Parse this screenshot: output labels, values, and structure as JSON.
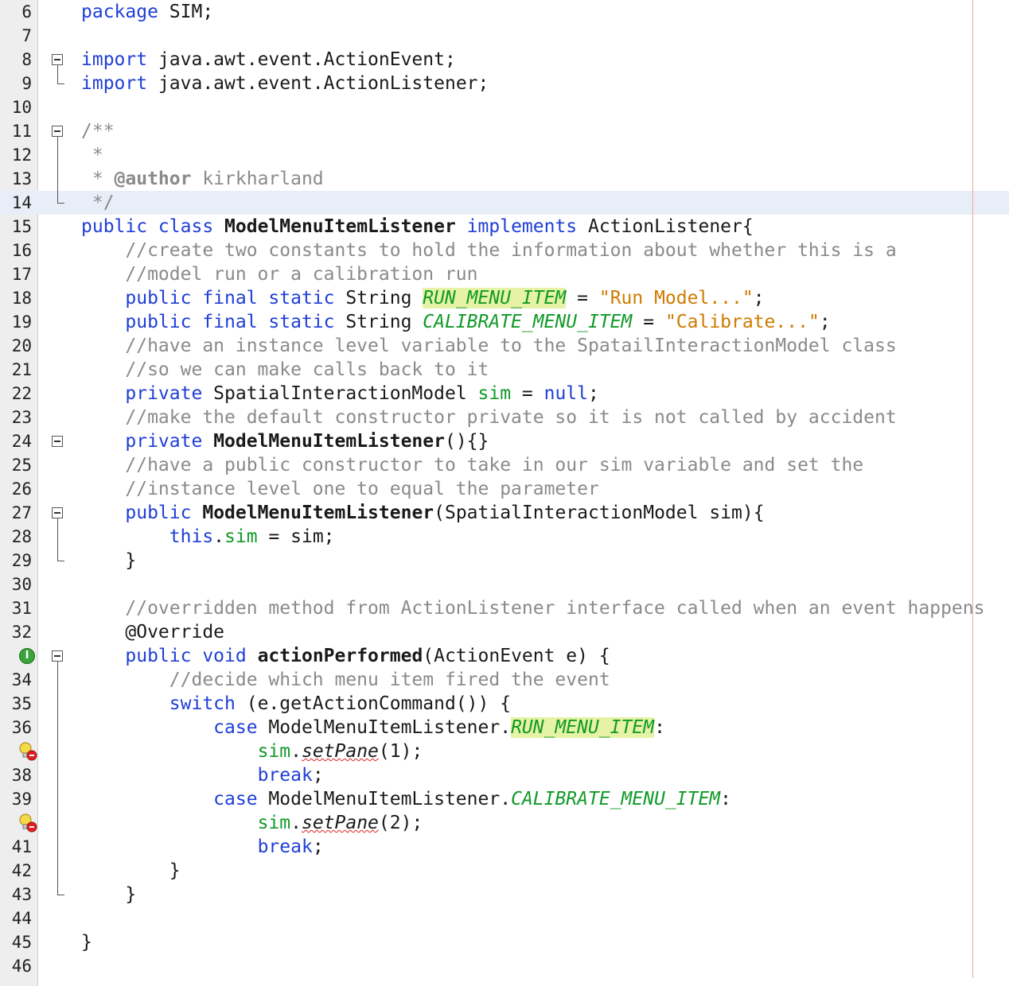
{
  "editor": {
    "lines": [
      {
        "n": "6",
        "html": "<span class=\"kw\">package</span> SIM;"
      },
      {
        "n": "7",
        "html": ""
      },
      {
        "n": "8",
        "html": "<span class=\"kw\">import</span> java.awt.event.ActionEvent;"
      },
      {
        "n": "9",
        "html": "<span class=\"kw\">import</span> java.awt.event.ActionListener;"
      },
      {
        "n": "10",
        "html": ""
      },
      {
        "n": "11",
        "html": "<span class=\"jd\">/**</span>"
      },
      {
        "n": "12",
        "html": "<span class=\"jd\"> *</span>"
      },
      {
        "n": "13",
        "html": "<span class=\"jd\"> * </span><span class=\"jdtag\">@author</span><span class=\"jd\"> kirkharland</span>"
      },
      {
        "n": "14",
        "html": "<span class=\"jd\"> */</span>"
      },
      {
        "n": "15",
        "html": "<span class=\"kw\">public class</span> <span class=\"b\">ModelMenuItemListener</span> <span class=\"kw\">implements</span> ActionListener{"
      },
      {
        "n": "16",
        "html": "    <span class=\"cm\">//create two constants to hold the information about whether this is a</span>"
      },
      {
        "n": "17",
        "html": "    <span class=\"cm\">//model run or a calibration run</span>"
      },
      {
        "n": "18",
        "html": "    <span class=\"kw\">public final static</span> String <span class=\"cst hl\">RUN_MENU_ITEM</span> = <span class=\"str\">\"Run Model...\"</span>;"
      },
      {
        "n": "19",
        "html": "    <span class=\"kw\">public final static</span> String <span class=\"cst\">CALIBRATE_MENU_ITEM</span> = <span class=\"str\">\"Calibrate...\"</span>;"
      },
      {
        "n": "20",
        "html": "    <span class=\"cm\">//have an instance level variable to the SpatailInteractionModel class</span>"
      },
      {
        "n": "21",
        "html": "    <span class=\"cm\">//so we can make calls back to it</span>"
      },
      {
        "n": "22",
        "html": "    <span class=\"kw\">private</span> SpatialInteractionModel <span class=\"fld\">sim</span> = <span class=\"kw\">null</span>;"
      },
      {
        "n": "23",
        "html": "    <span class=\"cm\">//make the default constructor private so it is not called by accident</span>"
      },
      {
        "n": "24",
        "html": "    <span class=\"kw\">private</span> <span class=\"b\">ModelMenuItemListener</span>(){}"
      },
      {
        "n": "25",
        "html": "    <span class=\"cm\">//have a public constructor to take in our sim variable and set the</span>"
      },
      {
        "n": "26",
        "html": "    <span class=\"cm\">//instance level one to equal the parameter</span>"
      },
      {
        "n": "27",
        "html": "    <span class=\"kw\">public</span> <span class=\"b\">ModelMenuItemListener</span>(SpatialInteractionModel sim){"
      },
      {
        "n": "28",
        "html": "        <span class=\"kw\">this</span>.<span class=\"fld\">sim</span> = sim;"
      },
      {
        "n": "29",
        "html": "    }"
      },
      {
        "n": "30",
        "html": ""
      },
      {
        "n": "31",
        "html": "    <span class=\"cm\">//overridden method from ActionListener interface called when an event happens</span>"
      },
      {
        "n": "32",
        "html": "    <span class=\"ann\">@Override</span>"
      },
      {
        "n": "",
        "html": "    <span class=\"kw\">public void</span> <span class=\"b\">actionPerformed</span>(ActionEvent e) {"
      },
      {
        "n": "34",
        "html": "        <span class=\"cm\">//decide which menu item fired the event</span>"
      },
      {
        "n": "35",
        "html": "        <span class=\"kw\">switch</span> (e.getActionCommand()) {"
      },
      {
        "n": "36",
        "html": "            <span class=\"kw\">case</span> ModelMenuItemListener.<span class=\"cst hl\">RUN_MENU_ITEM</span>:"
      },
      {
        "n": "",
        "html": "                <span class=\"fld\">sim</span>.<span class=\"err\">setPane</span>(1);"
      },
      {
        "n": "38",
        "html": "                <span class=\"kw\">break</span>;"
      },
      {
        "n": "39",
        "html": "            <span class=\"kw\">case</span> ModelMenuItemListener.<span class=\"cst\">CALIBRATE_MENU_ITEM</span>:"
      },
      {
        "n": "",
        "html": "                <span class=\"fld\">sim</span>.<span class=\"err\">setPane</span>(2);"
      },
      {
        "n": "41",
        "html": "                <span class=\"kw\">break</span>;"
      },
      {
        "n": "42",
        "html": "        }"
      },
      {
        "n": "43",
        "html": "    }"
      },
      {
        "n": "44",
        "html": ""
      },
      {
        "n": "45",
        "html": "}"
      },
      {
        "n": "46",
        "html": ""
      }
    ],
    "current_line": "14",
    "gutter_icons": [
      {
        "line_index": 27,
        "icon": "implements-method-icon",
        "glyph": "I"
      },
      {
        "line_index": 31,
        "icon": "error-hint-bulb-icon"
      },
      {
        "line_index": 34,
        "icon": "error-hint-bulb-icon"
      }
    ]
  }
}
